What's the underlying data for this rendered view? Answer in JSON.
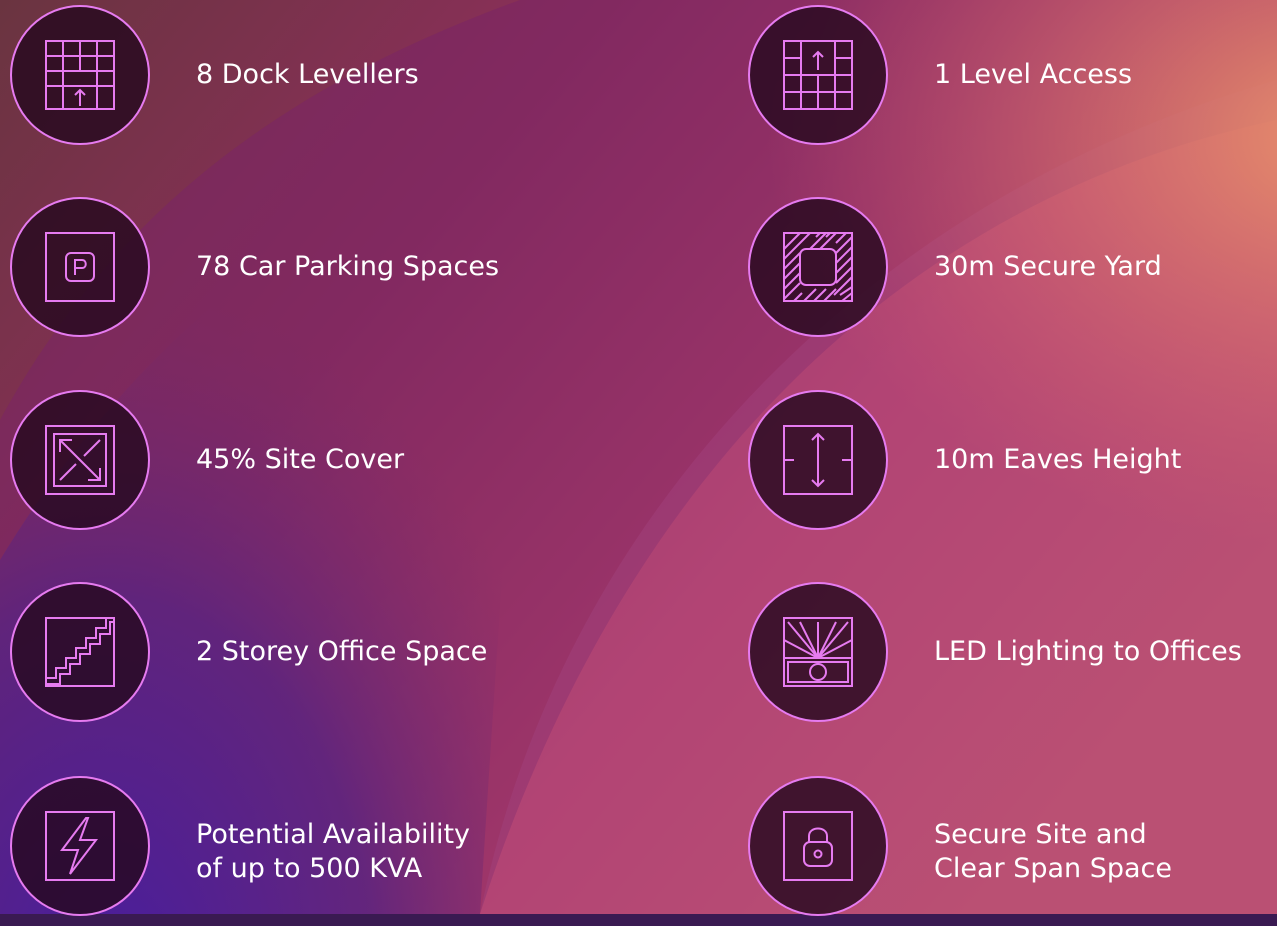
{
  "features": {
    "dock_levellers": {
      "label": "8 Dock Levellers",
      "icon": "dock-leveller-icon"
    },
    "level_access": {
      "label": "1 Level Access",
      "icon": "level-access-icon"
    },
    "car_parking": {
      "label": "78 Car Parking Spaces",
      "icon": "parking-icon"
    },
    "secure_yard": {
      "label": "30m Secure Yard",
      "icon": "secure-yard-icon"
    },
    "site_cover": {
      "label": "45% Site Cover",
      "icon": "site-cover-icon"
    },
    "eaves_height": {
      "label": "10m Eaves Height",
      "icon": "eaves-height-icon"
    },
    "office_space": {
      "label": "2 Storey Office Space",
      "icon": "stairs-icon"
    },
    "led_lighting": {
      "label": "LED Lighting to Offices",
      "icon": "lighting-icon"
    },
    "power": {
      "line1": "Potential Availability",
      "line2": "of up to 500 KVA",
      "icon": "lightning-icon"
    },
    "secure_site": {
      "line1": "Secure Site and",
      "line2": "Clear Span Space",
      "icon": "padlock-icon"
    }
  },
  "colors": {
    "accent": "#e67bf0",
    "circle_fill": "#26081e",
    "text": "#ffffff"
  }
}
